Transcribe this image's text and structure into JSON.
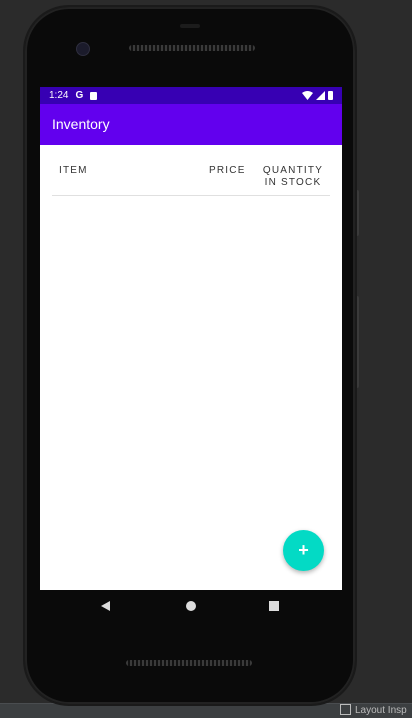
{
  "status_bar": {
    "time": "1:24",
    "google_icon": "G",
    "icons": [
      "google-icon",
      "sd-card-icon",
      "wifi-icon",
      "signal-icon",
      "battery-icon"
    ]
  },
  "app_bar": {
    "title": "Inventory"
  },
  "table": {
    "headers": {
      "item": "ITEM",
      "price": "PRICE",
      "quantity": "QUANTITY IN STOCK"
    }
  },
  "fab": {
    "icon": "add-icon",
    "symbol": "+"
  },
  "nav": {
    "icons": [
      "back-icon",
      "home-icon",
      "recents-icon"
    ]
  },
  "ide": {
    "layout_inspector_label": "Layout Insp"
  },
  "colors": {
    "status_bar": "#3700b3",
    "app_bar": "#6200ee",
    "fab": "#03dac5",
    "background": "#ffffff"
  }
}
